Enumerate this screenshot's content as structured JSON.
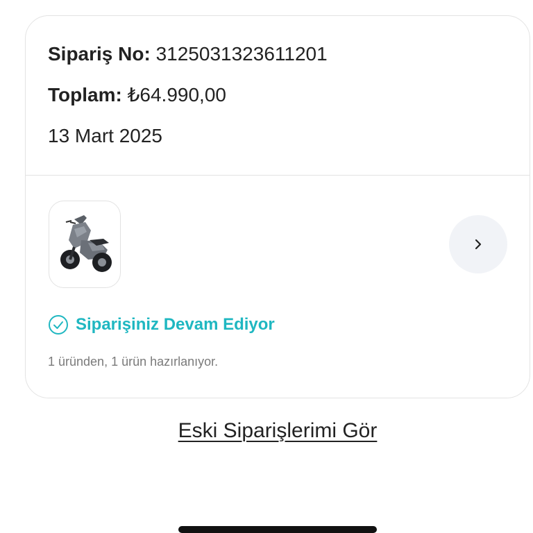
{
  "order": {
    "number_label": "Sipariş No:",
    "number_value": "3125031323611201",
    "total_label": "Toplam:",
    "total_value": "₺64.990,00",
    "date": "13 Mart 2025"
  },
  "product": {
    "image_icon": "scooter-image",
    "chevron_icon": "chevron-right-icon"
  },
  "status": {
    "icon": "check-circle-icon",
    "text": "Siparişiniz Devam Ediyor",
    "detail": "1 üründen, 1 ürün hazırlanıyor.",
    "color": "#1fb7c1"
  },
  "footer": {
    "old_orders_link": "Eski Siparişlerimi Gör"
  }
}
